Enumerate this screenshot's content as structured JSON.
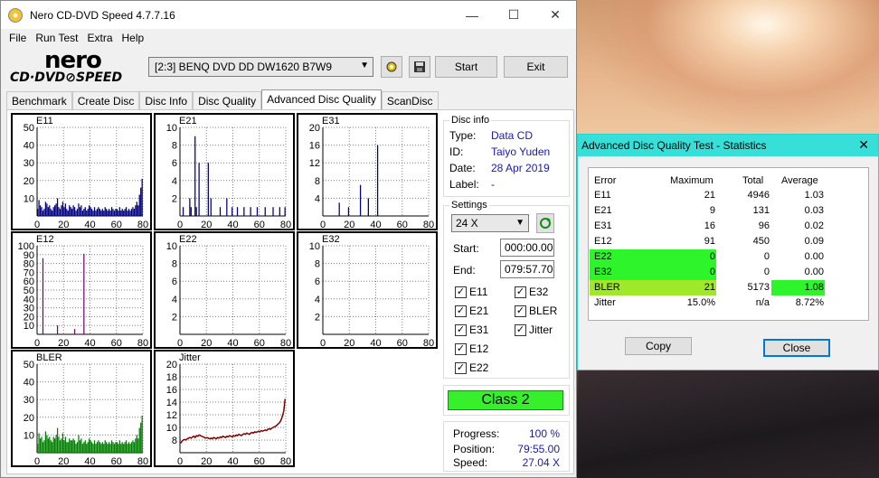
{
  "window": {
    "title": "Nero CD-DVD Speed 4.7.7.16"
  },
  "menu": [
    "File",
    "Run Test",
    "Extra",
    "Help"
  ],
  "toolbar": {
    "logo_nero": "nero",
    "logo_sub": "CD·DVD⊘SPEED",
    "drive": "[2:3]   BENQ DVD DD DW1620 B7W9",
    "start": "Start",
    "exit": "Exit"
  },
  "tabs": [
    "Benchmark",
    "Create Disc",
    "Disc Info",
    "Disc Quality",
    "Advanced Disc Quality",
    "ScanDisc"
  ],
  "active_tab": "Advanced Disc Quality",
  "disc_info": {
    "title": "Disc info",
    "type_label": "Type:",
    "type": "Data CD",
    "id_label": "ID:",
    "id": "Taiyo Yuden",
    "date_label": "Date:",
    "date": "28 Apr 2019",
    "label_label": "Label:",
    "label": "-"
  },
  "settings": {
    "title": "Settings",
    "speed": "24 X",
    "start_label": "Start:",
    "start": "000:00.00",
    "end_label": "End:",
    "end": "079:57.70",
    "checks": [
      {
        "label": "E11",
        "checked": true
      },
      {
        "label": "E32",
        "checked": true
      },
      {
        "label": "E21",
        "checked": true
      },
      {
        "label": "BLER",
        "checked": true
      },
      {
        "label": "E31",
        "checked": true
      },
      {
        "label": "Jitter",
        "checked": true
      },
      {
        "label": "E12",
        "checked": true
      },
      {
        "label": "E22",
        "checked": true
      }
    ]
  },
  "class_result": "Class 2",
  "progress": {
    "progress_label": "Progress:",
    "progress": "100 %",
    "position_label": "Position:",
    "position": "79:55.00",
    "speed_label": "Speed:",
    "speed": "27.04 X"
  },
  "chart_data": [
    {
      "name": "E11",
      "type": "bar",
      "color": "#000080",
      "xticks": [
        0,
        20,
        40,
        60,
        80
      ],
      "yticks": [
        10,
        20,
        30,
        40,
        50
      ],
      "ylim": [
        0,
        50
      ],
      "xlim": [
        0,
        80
      ],
      "values": [
        4,
        9,
        6,
        5,
        3,
        4,
        8,
        7,
        5,
        6,
        4,
        3,
        5,
        6,
        7,
        10,
        5,
        4,
        6,
        8,
        5,
        7,
        4,
        3,
        6,
        5,
        4,
        6,
        5,
        3,
        4,
        7,
        5,
        6,
        3,
        4,
        5,
        3,
        4,
        6,
        5,
        4,
        3,
        5,
        3,
        4,
        5,
        4,
        3,
        4,
        3,
        5,
        4,
        3,
        4,
        3,
        5,
        4,
        3,
        4,
        4,
        3,
        5,
        3,
        4,
        3,
        4,
        5,
        3,
        4,
        3,
        4,
        5,
        4,
        6,
        8,
        6,
        12,
        16,
        21
      ]
    },
    {
      "name": "E21",
      "type": "bar",
      "color": "#000080",
      "xticks": [
        0,
        20,
        40,
        60,
        80
      ],
      "yticks": [
        2,
        4,
        6,
        8,
        10
      ],
      "ylim": [
        0,
        10
      ],
      "xlim": [
        0,
        80
      ],
      "values": [
        0,
        0,
        1,
        0,
        0,
        0,
        0,
        2,
        1,
        0,
        0,
        9,
        1,
        0,
        6,
        0,
        0,
        0,
        0,
        0,
        0,
        6,
        0,
        2,
        0,
        0,
        0,
        0,
        0,
        0,
        1,
        0,
        0,
        0,
        0,
        2,
        0,
        0,
        0,
        1,
        0,
        0,
        0,
        1,
        0,
        0,
        0,
        0,
        1,
        0,
        0,
        0,
        0,
        1,
        0,
        0,
        0,
        0,
        1,
        0,
        0,
        0,
        0,
        0,
        1,
        0,
        0,
        0,
        0,
        0,
        1,
        0,
        0,
        0,
        0,
        1,
        0,
        0,
        0,
        1
      ]
    },
    {
      "name": "E31",
      "type": "bar",
      "color": "#000080",
      "xticks": [
        0,
        20,
        40,
        60,
        80
      ],
      "yticks": [
        4,
        8,
        12,
        16,
        20
      ],
      "ylim": [
        0,
        20
      ],
      "xlim": [
        0,
        80
      ],
      "values": [
        0,
        0,
        0,
        0,
        0,
        0,
        0,
        0,
        0,
        0,
        0,
        0,
        3,
        0,
        0,
        0,
        0,
        0,
        0,
        2,
        0,
        0,
        0,
        0,
        0,
        0,
        0,
        0,
        7,
        0,
        0,
        0,
        0,
        0,
        4,
        0,
        0,
        0,
        0,
        0,
        0,
        16,
        0,
        0,
        0,
        0,
        0,
        0,
        0,
        0,
        0,
        0,
        0,
        0,
        0,
        0,
        0,
        0,
        0,
        0,
        0,
        0,
        0,
        0,
        0,
        0,
        0,
        0,
        0,
        0,
        0,
        0,
        0,
        0,
        0,
        0,
        0,
        0,
        0,
        0
      ]
    },
    {
      "name": "E12",
      "type": "bar",
      "color": "#800080",
      "xticks": [
        0,
        20,
        40,
        60,
        80
      ],
      "yticks": [
        10,
        20,
        30,
        40,
        50,
        60,
        70,
        80,
        90,
        100
      ],
      "ylim": [
        0,
        100
      ],
      "xlim": [
        0,
        80
      ],
      "values": [
        0,
        0,
        0,
        0,
        86,
        0,
        0,
        0,
        0,
        0,
        0,
        0,
        0,
        0,
        0,
        10,
        0,
        0,
        0,
        0,
        0,
        0,
        0,
        0,
        0,
        0,
        0,
        0,
        6,
        0,
        0,
        0,
        0,
        0,
        0,
        91,
        0,
        0,
        0,
        0,
        0,
        0,
        0,
        0,
        0,
        0,
        0,
        0,
        0,
        0,
        0,
        0,
        0,
        0,
        0,
        0,
        0,
        0,
        0,
        0,
        0,
        0,
        0,
        0,
        0,
        0,
        0,
        0,
        0,
        0,
        0,
        0,
        0,
        0,
        0,
        0,
        0,
        0,
        0,
        0
      ]
    },
    {
      "name": "E22",
      "type": "bar",
      "color": "#800080",
      "xticks": [
        0,
        20,
        40,
        60,
        80
      ],
      "yticks": [
        2,
        4,
        6,
        8,
        10
      ],
      "ylim": [
        0,
        10
      ],
      "xlim": [
        0,
        80
      ],
      "values": []
    },
    {
      "name": "E32",
      "type": "bar",
      "color": "#800080",
      "xticks": [
        0,
        20,
        40,
        60,
        80
      ],
      "yticks": [
        2,
        4,
        6,
        8,
        10
      ],
      "ylim": [
        0,
        10
      ],
      "xlim": [
        0,
        80
      ],
      "values": []
    },
    {
      "name": "BLER",
      "type": "bar",
      "color": "#008000",
      "xticks": [
        0,
        20,
        40,
        60,
        80
      ],
      "yticks": [
        10,
        20,
        30,
        40,
        50
      ],
      "ylim": [
        0,
        50
      ],
      "xlim": [
        0,
        80
      ],
      "values": [
        5,
        11,
        8,
        9,
        6,
        7,
        12,
        10,
        8,
        9,
        7,
        6,
        9,
        8,
        10,
        14,
        9,
        7,
        8,
        11,
        7,
        9,
        6,
        6,
        8,
        7,
        7,
        8,
        7,
        5,
        6,
        10,
        7,
        8,
        5,
        6,
        7,
        5,
        6,
        8,
        7,
        6,
        5,
        7,
        5,
        6,
        7,
        6,
        5,
        6,
        5,
        7,
        6,
        5,
        6,
        5,
        7,
        6,
        5,
        6,
        6,
        5,
        7,
        5,
        6,
        5,
        6,
        7,
        5,
        6,
        5,
        6,
        7,
        6,
        8,
        10,
        8,
        14,
        17,
        21
      ]
    },
    {
      "name": "Jitter",
      "type": "line",
      "color": "#800000",
      "xticks": [
        0,
        20,
        40,
        60,
        80
      ],
      "yticks": [
        8,
        10,
        12,
        14,
        16,
        18,
        20
      ],
      "ylim": [
        6,
        20
      ],
      "xlim": [
        0,
        80
      ],
      "values": [
        7.5,
        7.8,
        8.0,
        8.1,
        8.0,
        8.2,
        8.3,
        8.4,
        8.3,
        8.5,
        8.6,
        8.4,
        8.7,
        8.6,
        8.8,
        8.7,
        8.6,
        8.5,
        8.4,
        8.3,
        8.4,
        8.3,
        8.2,
        8.3,
        8.2,
        8.4,
        8.3,
        8.2,
        8.4,
        8.3,
        8.5,
        8.4,
        8.6,
        8.5,
        8.4,
        8.6,
        8.5,
        8.7,
        8.6,
        8.5,
        8.7,
        8.6,
        8.8,
        8.7,
        8.9,
        8.8,
        8.7,
        8.9,
        9.0,
        8.9,
        9.1,
        9.0,
        8.9,
        9.1,
        9.2,
        9.1,
        9.3,
        9.2,
        9.3,
        9.4,
        9.3,
        9.5,
        9.4,
        9.5,
        9.6,
        9.5,
        9.7,
        9.8,
        9.7,
        9.9,
        10.0,
        10.1,
        10.2,
        10.4,
        10.6,
        10.8,
        11.2,
        11.8,
        12.6,
        14.5
      ]
    }
  ],
  "stats": {
    "title": "Advanced Disc Quality Test - Statistics",
    "headers": [
      "Error",
      "Maximum",
      "Total",
      "Average"
    ],
    "rows": [
      {
        "name": "E11",
        "max": "21",
        "total": "4946",
        "avg": "1.03",
        "hl": ""
      },
      {
        "name": "E21",
        "max": "9",
        "total": "131",
        "avg": "0.03",
        "hl": ""
      },
      {
        "name": "E31",
        "max": "16",
        "total": "96",
        "avg": "0.02",
        "hl": ""
      },
      {
        "name": "E12",
        "max": "91",
        "total": "450",
        "avg": "0.09",
        "hl": ""
      },
      {
        "name": "E22",
        "max": "0",
        "total": "0",
        "avg": "0.00",
        "hl": "#2ef52b"
      },
      {
        "name": "E32",
        "max": "0",
        "total": "0",
        "avg": "0.00",
        "hl": "#2ef52b"
      },
      {
        "name": "BLER",
        "max": "21",
        "total": "5173",
        "avg": "1.08",
        "hl": "#9fe82a"
      },
      {
        "name": "Jitter",
        "max": "15.0%",
        "total": "n/a",
        "avg": "8.72%",
        "hl": ""
      }
    ],
    "copy": "Copy",
    "close": "Close"
  }
}
